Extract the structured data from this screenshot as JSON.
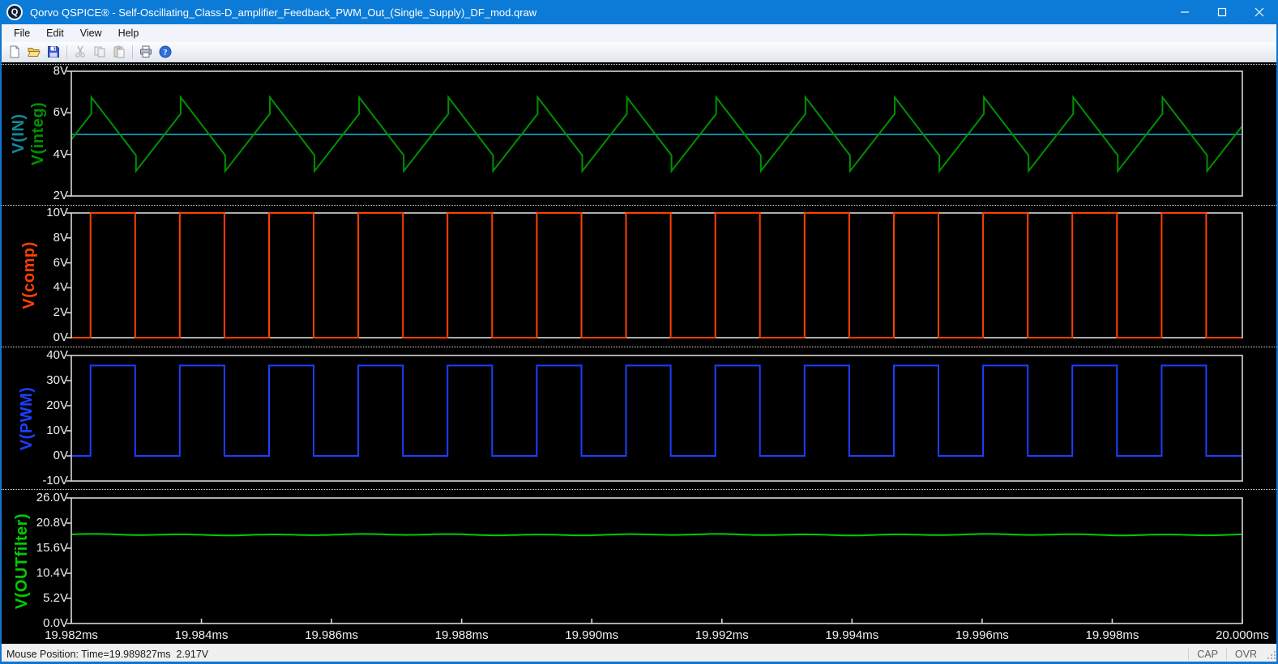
{
  "window": {
    "title": "Qorvo QSPICE® - Self-Oscillating_Class-D_amplifier_Feedback_PWM_Out_(Single_Supply)_DF_mod.qraw",
    "icon_letter": "Q"
  },
  "menu": {
    "items": [
      "File",
      "Edit",
      "View",
      "Help"
    ]
  },
  "toolbar": {
    "buttons": [
      "new-document",
      "open",
      "save",
      "cut",
      "copy",
      "paste",
      "print",
      "help"
    ]
  },
  "statusbar": {
    "mouse_position": "Mouse Position: Time=19.989827ms  2.917V",
    "cap": "CAP",
    "ovr": "OVR"
  },
  "x_axis": {
    "unit": "ms",
    "labels": [
      "19.982ms",
      "19.984ms",
      "19.986ms",
      "19.988ms",
      "19.990ms",
      "19.992ms",
      "19.994ms",
      "19.996ms",
      "19.998ms",
      "20.000ms"
    ],
    "values_ms": [
      19.982,
      19.984,
      19.986,
      19.988,
      19.99,
      19.992,
      19.994,
      19.996,
      19.998,
      20.0
    ]
  },
  "chart_data": [
    {
      "type": "line",
      "pane": 1,
      "y_range": [
        2,
        8
      ],
      "y_ticks": [
        8,
        6,
        4,
        2
      ],
      "y_tick_labels": [
        "8V",
        "6V",
        "4V",
        "2V"
      ],
      "grid": false,
      "legend_position": "left-rotated",
      "series": [
        {
          "name": "V(IN)",
          "color": "#0f8a9c",
          "kind": "dc",
          "value_v": 4.96
        },
        {
          "name": "V(integ)",
          "color": "#009000",
          "kind": "triangle_hysteresis",
          "period_us": 1.372,
          "first_peak_us": 0.308,
          "fall_fraction": 0.5,
          "v_peak_low": 5.95,
          "v_peak_high": 6.75,
          "v_trough_high": 3.95,
          "v_trough_low": 3.2
        }
      ]
    },
    {
      "type": "line",
      "pane": 2,
      "y_range": [
        0,
        10
      ],
      "y_ticks": [
        10,
        8,
        6,
        4,
        2,
        0
      ],
      "y_tick_labels": [
        "10V",
        "8V",
        "6V",
        "4V",
        "2V",
        "0V"
      ],
      "grid": false,
      "legend_position": "left-rotated",
      "series": [
        {
          "name": "V(comp)",
          "color": "#ff4000",
          "kind": "square",
          "period_us": 1.372,
          "first_rise_us": 0.295,
          "high_us": 0.686,
          "v_low": 0,
          "v_high": 10
        }
      ]
    },
    {
      "type": "line",
      "pane": 3,
      "y_range": [
        -10,
        40
      ],
      "y_ticks": [
        40,
        30,
        20,
        10,
        0,
        -10
      ],
      "y_tick_labels": [
        "40V",
        "30V",
        "20V",
        "10V",
        "0V",
        "-10V"
      ],
      "grid": false,
      "legend_position": "left-rotated",
      "series": [
        {
          "name": "V(PWM)",
          "color": "#1b3fff",
          "kind": "square",
          "period_us": 1.372,
          "first_rise_us": 0.295,
          "high_us": 0.686,
          "v_low": 0,
          "v_high": 36
        }
      ]
    },
    {
      "type": "line",
      "pane": 4,
      "y_range": [
        0,
        26
      ],
      "y_ticks": [
        26,
        20.8,
        15.6,
        10.4,
        5.2,
        0
      ],
      "y_tick_labels": [
        "26.0V",
        "20.8V",
        "15.6V",
        "10.4V",
        "5.2V",
        "0.0V"
      ],
      "grid": false,
      "legend_position": "left-rotated",
      "series": [
        {
          "name": "V(OUTfilter)",
          "color": "#00cc00",
          "kind": "ripple",
          "mean_v": 18.4,
          "ripple_amp_v": 0.1,
          "ripple_period_us": 1.372,
          "slow_amp_v": 0.06,
          "slow_period_us": 4.7
        }
      ]
    }
  ]
}
